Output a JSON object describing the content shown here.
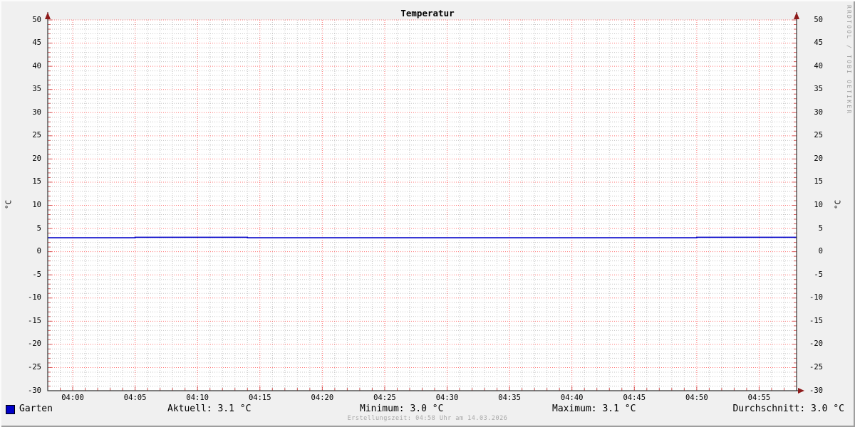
{
  "title": "Temperatur",
  "y_axis_unit": "°C",
  "watermark": "RRDTOOL / TOBI OETIKER",
  "footer": "Erstellungszeit: 04:58 Uhr am 14.03.2026",
  "legend": {
    "series_label": "Garten",
    "series_color": "#0000c8",
    "aktuell": "Aktuell: 3.1 °C",
    "minimum": "Minimum: 3.0 °C",
    "maximum": "Maximum: 3.1 °C",
    "durchschnitt": "Durchschnitt: 3.0 °C"
  },
  "colors": {
    "background": "#f0f0f0",
    "canvas": "#ffffff",
    "grid_minor": "#bbbbbb",
    "grid_major": "#ff0000",
    "tick": "#cc3333",
    "axis": "#333333",
    "arrow": "#8e1b1b",
    "series": "#0000c8"
  },
  "chart_data": {
    "type": "line",
    "title": "Temperatur",
    "ylabel": "°C",
    "ylim": [
      -30,
      50
    ],
    "y_tick_major": 5,
    "y_tick_minor": 1,
    "x_start": "03:58",
    "x_end": "04:58",
    "x_tick_minor_minutes": 1,
    "x_tick_major_minutes": 5,
    "x_tick_labels": [
      "04:00",
      "04:05",
      "04:10",
      "04:15",
      "04:20",
      "04:25",
      "04:30",
      "04:35",
      "04:40",
      "04:45",
      "04:50",
      "04:55"
    ],
    "grid": true,
    "legend_position": "bottom",
    "series": [
      {
        "name": "Garten",
        "color": "#0000c8",
        "step": true,
        "points": [
          [
            "03:58",
            3.0
          ],
          [
            "04:05",
            3.1
          ],
          [
            "04:14",
            3.0
          ],
          [
            "04:50",
            3.1
          ],
          [
            "04:58",
            3.1
          ]
        ]
      }
    ],
    "stats": {
      "aktuell": 3.1,
      "minimum": 3.0,
      "maximum": 3.1,
      "durchschnitt": 3.0
    }
  }
}
